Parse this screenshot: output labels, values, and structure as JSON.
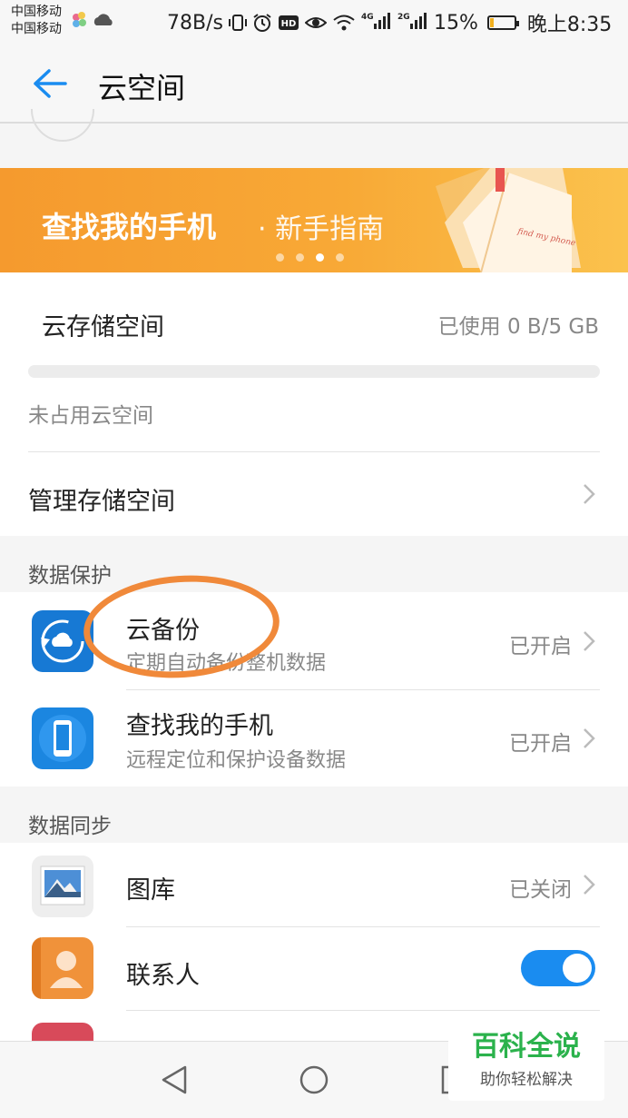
{
  "status_bar": {
    "carrier1": "中国移动",
    "carrier2": "中国移动",
    "speed": "78B/s",
    "network1": "4G",
    "network2": "2G",
    "battery": "15%",
    "battery_level": 0.15,
    "time": "晚上8:35"
  },
  "app_bar": {
    "title": "云空间"
  },
  "banner": {
    "title": "查找我的手机",
    "subtitle": "· 新手指南",
    "book_text": "find my phone",
    "page_count": 4,
    "active_page": 2
  },
  "storage": {
    "label": "云存储空间",
    "used": "已使用 0 B/5 GB",
    "used_fraction": 0,
    "free_label": "未占用云空间",
    "manage_label": "管理存储空间"
  },
  "data_protection": {
    "header": "数据保护",
    "items": [
      {
        "title": "云备份",
        "subtitle": "定期自动备份整机数据",
        "status": "已开启",
        "icon": "cloud-backup-icon"
      },
      {
        "title": "查找我的手机",
        "subtitle": "远程定位和保护设备数据",
        "status": "已开启",
        "icon": "find-phone-icon"
      }
    ]
  },
  "data_sync": {
    "header": "数据同步",
    "items": [
      {
        "title": "图库",
        "status": "已关闭",
        "icon": "gallery-icon"
      },
      {
        "title": "联系人",
        "toggle_on": true,
        "icon": "contacts-icon"
      }
    ]
  },
  "watermark": {
    "title": "百科全说",
    "subtitle": "助你轻松解决"
  },
  "colors": {
    "accent": "#1a8cf0",
    "banner": "#f59a2e",
    "annotation": "#f0893a",
    "watermark": "#2bb24c"
  }
}
